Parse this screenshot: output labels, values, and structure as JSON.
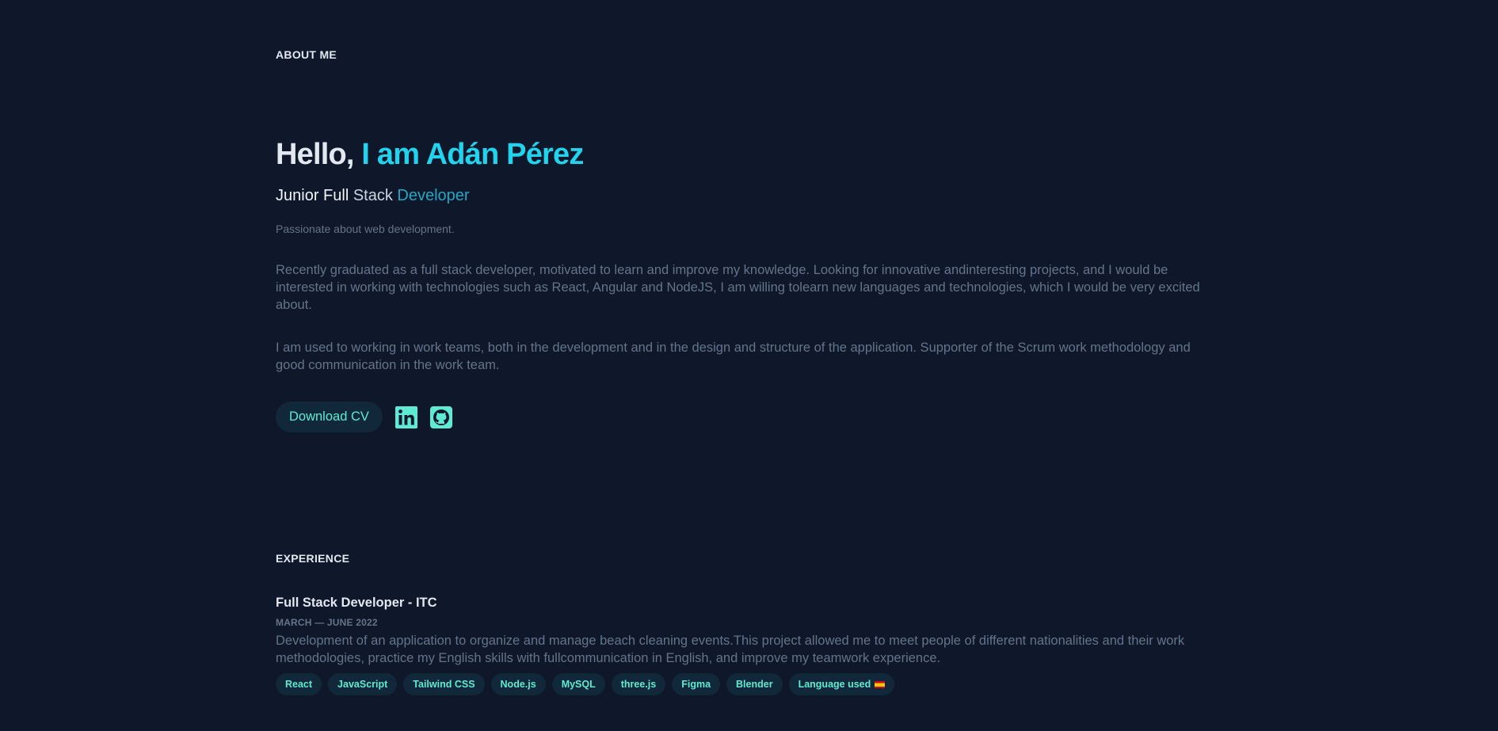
{
  "about": {
    "section_label": "ABOUT ME",
    "hello_prefix": "Hello, ",
    "hello_name": "I am Adán Pérez",
    "role_part1": "Junior Full",
    "role_part2": " Stack ",
    "role_part3": "Developer",
    "tagline": "Passionate about web development.",
    "paragraph1": "Recently graduated as a full stack developer, motivated to learn and improve my knowledge. Looking for innovative andinteresting projects, and I would be interested in working with technologies such as React, Angular and NodeJS, I am willing tolearn new languages and technologies, which I would be very excited about.",
    "paragraph2": "I am used to working in work teams, both in the development and in the design and structure of the application. Supporter of the Scrum work methodology and good communication in the work team.",
    "cv_button_label": "Download CV",
    "social_icons": [
      "linkedin-icon",
      "github-icon"
    ]
  },
  "experience": {
    "section_label": "EXPERIENCE",
    "job": {
      "title": "Full Stack Developer - ITC",
      "date": "MARCH — JUNE 2022",
      "description": "Development of an application to organize and manage beach cleaning events.This project allowed me to meet people of different nationalities and their work methodologies, practice my English skills with fullcommunication in English, and improve my teamwork experience.",
      "tags": [
        "React",
        "JavaScript",
        "Tailwind CSS",
        "Node.js",
        "MySQL",
        "three.js",
        "Figma",
        "Blender",
        "Language used"
      ]
    }
  },
  "colors": {
    "background": "#0f172a",
    "accent": "#22d3ee",
    "teal": "#5eead4",
    "muted": "#64748b",
    "heading": "#e2e8f0"
  }
}
